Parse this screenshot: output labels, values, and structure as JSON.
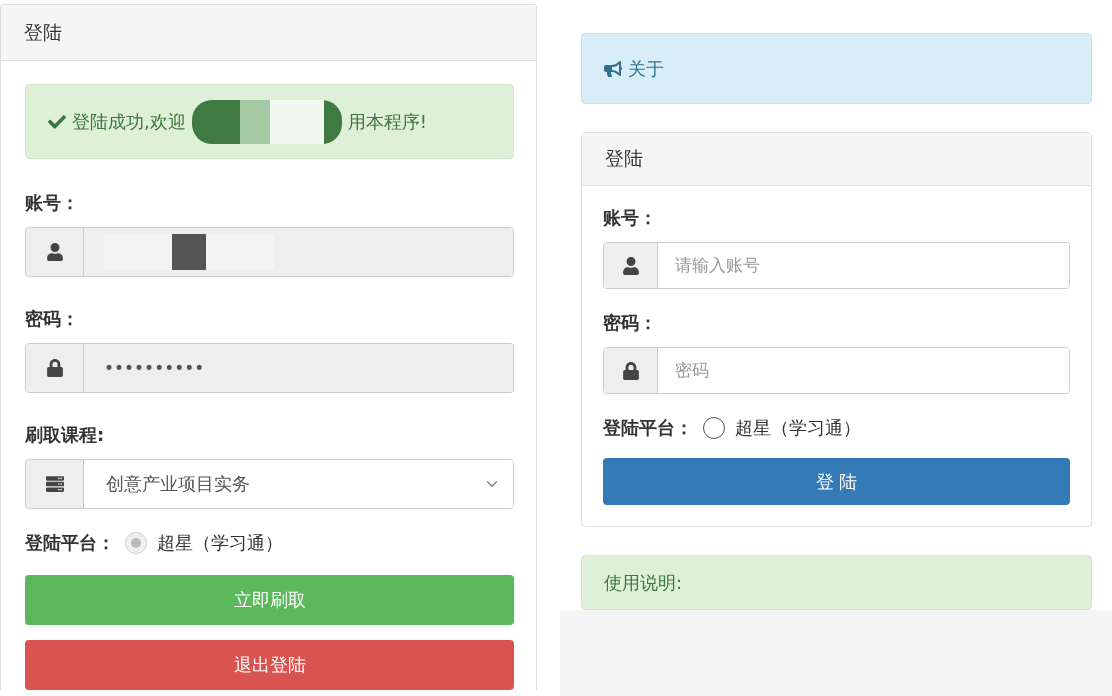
{
  "session_panel": {
    "title": "登陆",
    "alert": {
      "text_before": "登陆成功,欢迎",
      "redacted": true,
      "text_after": "用本程序!"
    },
    "fields": [
      {
        "kind": "account",
        "label": "账号：",
        "disabled": true,
        "redacted": true
      },
      {
        "kind": "password",
        "label": "密码：",
        "disabled": true,
        "value": "••••••••••"
      },
      {
        "kind": "course",
        "label": "刷取课程:",
        "value": "创意产业项目实务"
      }
    ],
    "platform": {
      "label": "登陆平台：",
      "option": "超星（学习通）",
      "checked": true,
      "disabled": true
    },
    "buttons": [
      {
        "kind": "success",
        "label": "立即刷取"
      },
      {
        "kind": "danger",
        "label": "退出登陆"
      }
    ]
  },
  "about_alert": {
    "text": "关于"
  },
  "login_panel": {
    "title": "登陆",
    "fields": [
      {
        "kind": "account",
        "label": "账号：",
        "disabled": false,
        "placeholder": "请输入账号"
      },
      {
        "kind": "password",
        "label": "密码：",
        "disabled": false,
        "placeholder": "密码"
      }
    ],
    "platform": {
      "label": "登陆平台：",
      "option": "超星（学习通）",
      "checked": false,
      "disabled": false
    },
    "buttons": [
      {
        "kind": "primary",
        "label": "登 陆"
      }
    ]
  },
  "usage_alert": {
    "text": "使用说明:"
  }
}
